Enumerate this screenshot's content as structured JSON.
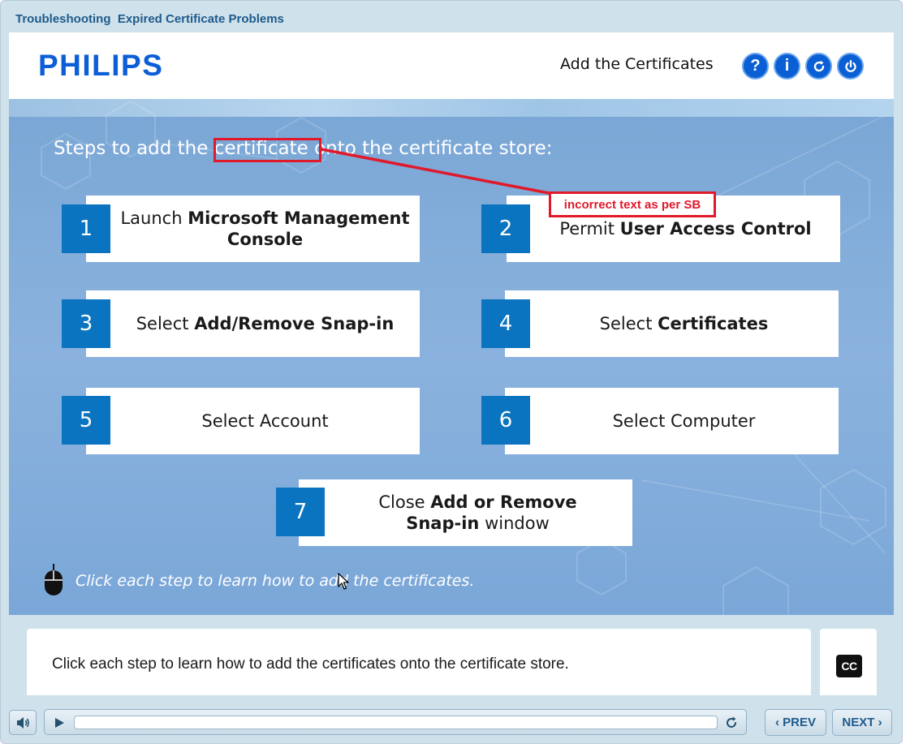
{
  "app": {
    "course_title": "Troubleshooting  Expired Certificate Problems",
    "logo_text": "PHILIPS",
    "lesson_title": "Add the Certificates",
    "brand_color": "#0b5ed7"
  },
  "header_buttons": [
    {
      "name": "help",
      "glyph": "?",
      "icon": "help-icon"
    },
    {
      "name": "info",
      "glyph": "i",
      "icon": "info-icon"
    },
    {
      "name": "replay",
      "icon": "replay-icon"
    },
    {
      "name": "exit",
      "icon": "power-icon"
    }
  ],
  "content": {
    "heading_before": "Steps to add the ",
    "heading_highlight": "certificate",
    "heading_after": " onto the certificate store:",
    "steps": [
      {
        "number": "1",
        "text_plain": "Launch ",
        "text_bold": "Microsoft Management Console",
        "text_tail": ""
      },
      {
        "number": "2",
        "text_plain": "Permit ",
        "text_bold": "User Access Control",
        "text_tail": ""
      },
      {
        "number": "3",
        "text_plain": "Select ",
        "text_bold": "Add/Remove Snap-in",
        "text_tail": ""
      },
      {
        "number": "4",
        "text_plain": "Select ",
        "text_bold": "Certificates",
        "text_tail": ""
      },
      {
        "number": "5",
        "text_plain": "Select Account",
        "text_bold": "",
        "text_tail": ""
      },
      {
        "number": "6",
        "text_plain": "Select Computer",
        "text_bold": "",
        "text_tail": ""
      },
      {
        "number": "7",
        "text_plain": "Close ",
        "text_bold": "Add or Remove Snap-in",
        "text_tail": " window"
      }
    ],
    "hint": "Click each step to learn how to add the certificates."
  },
  "annotation": {
    "label": "incorrect text as per SB",
    "color": "#e0192b"
  },
  "caption": {
    "text": "Click each step to learn how to add the certificates onto the certificate store.",
    "cc_label": "CC"
  },
  "controls": {
    "prev_label": "PREV",
    "next_label": "NEXT"
  }
}
